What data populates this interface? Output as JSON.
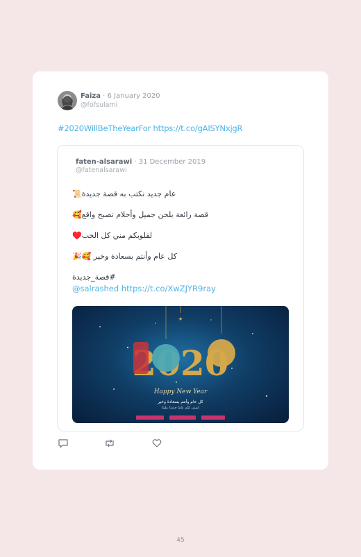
{
  "tweet": {
    "author_name": "Faiza",
    "separator": " · ",
    "date": "6 January 2020",
    "handle": "@fofsulami",
    "text": "#2020WillBeTheYearFor https://t.co/gAISYNxjgR"
  },
  "quoted_tweet": {
    "author_name": "faten-alsarawi",
    "separator": " · ",
    "date": "31 December 2019",
    "handle": "@fatenalsarawi",
    "lines": [
      "عام جديد نكتب به قصة جديدة📜",
      "قصة رائعة بلحن جميل وأحلام تصبح واقع🥰",
      "لقلوبكم مني كل الحب♥️",
      "كل عام وأنتم بسعادة وخير 🥰🎉",
      "#قصة_جديدة"
    ],
    "mention": "@salrashed",
    "link": "https://t.co/XwZJYR9ray",
    "image": {
      "year": "2020",
      "greeting": "Happy New Year",
      "arabic_line_1": "كل عام وأنتم بسعادة وخير",
      "arabic_line_2": "اتمنى لكم عاما جديدا مليئا",
      "accent_color": "#d4a84b",
      "background_color": "#0b2a52"
    }
  },
  "actions": {
    "reply_icon": "reply-icon",
    "retweet_icon": "retweet-icon",
    "like_icon": "heart-icon"
  },
  "page_number": "45",
  "colors": {
    "page_background": "#f5e6e8",
    "link_blue": "#4fb3e6",
    "muted_text": "#9aa0a8"
  }
}
